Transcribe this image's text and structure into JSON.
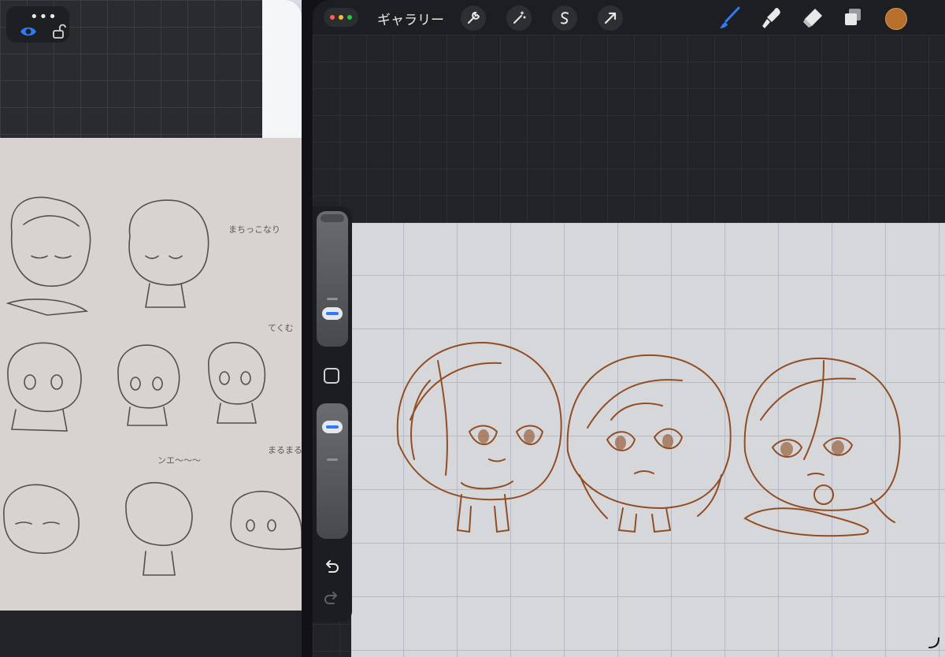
{
  "reference_panel": {
    "controls": {
      "dots_icon": "more-dots-icon",
      "eye_icon": "eye-icon",
      "lock_icon": "lock-icon",
      "eye_color": "#2f7bf6"
    },
    "notes": [
      "まちっこなり",
      "てくむ",
      "ンエ〜〜〜",
      "まるまる"
    ]
  },
  "toolbar": {
    "gallery_label": "ギャラリー",
    "left_tools": [
      "wrench-icon",
      "magic-wand-icon",
      "selection-icon",
      "transform-arrow-icon"
    ],
    "right_tools": [
      "brush-icon",
      "smudge-icon",
      "eraser-icon",
      "layers-icon"
    ],
    "active_tool": "brush-icon",
    "current_color": "#b86f2c",
    "window_dot_colors": [
      "#ff5f57",
      "#febc2e",
      "#28c840"
    ]
  },
  "sidebar": {
    "size_slider_label": "brush-size-slider",
    "opacity_slider_label": "opacity-slider",
    "modify_button": "modify-square-icon",
    "undo": "undo-icon",
    "redo": "redo-icon"
  }
}
